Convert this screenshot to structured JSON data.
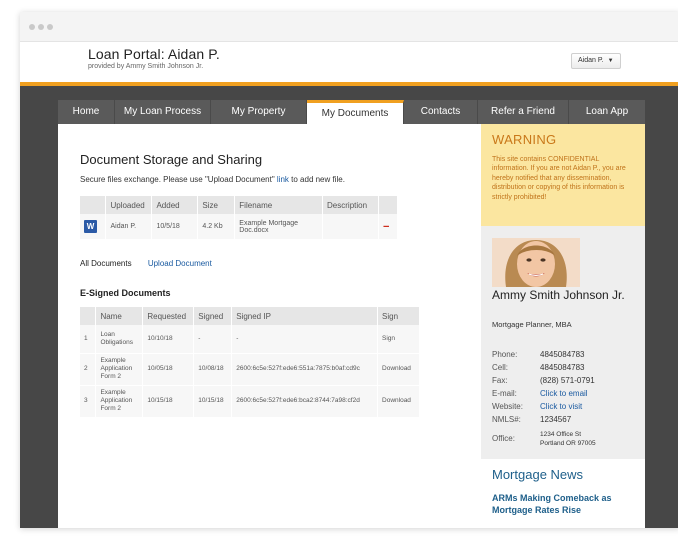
{
  "portal": {
    "title": "Loan Portal: Aidan P.",
    "subtitle": "provided by Ammy Smith Johnson Jr."
  },
  "user_menu": {
    "label": "Aidan P."
  },
  "nav": {
    "items": [
      {
        "label": "Home"
      },
      {
        "label": "My Loan Process"
      },
      {
        "label": "My Property"
      },
      {
        "label": "My Documents",
        "active": true
      },
      {
        "label": "Contacts"
      },
      {
        "label": "Refer a Friend"
      },
      {
        "label": "Loan App"
      }
    ]
  },
  "documents": {
    "title": "Document Storage and Sharing",
    "desc_prefix": "Secure files exchange. Please use \"Upload Document\" ",
    "desc_link": "link",
    "desc_suffix": " to add new file.",
    "table": {
      "headers": [
        "Uploaded",
        "Added",
        "Size",
        "Filename",
        "Description"
      ],
      "rows": [
        {
          "icon": "word-document-icon",
          "uploaded": "Aidan P.",
          "added": "10/5/18",
          "size": "4.2 Kb",
          "filename": "Example Mortgage Doc.docx",
          "description": "",
          "remove": "−"
        }
      ]
    },
    "tabs": {
      "all": "All Documents",
      "upload": "Upload Document"
    }
  },
  "esigned": {
    "title": "E-Signed Documents",
    "headers": [
      "",
      "Name",
      "Requested",
      "Signed",
      "Signed IP",
      "Sign"
    ],
    "rows": [
      {
        "num": "1",
        "name": "Loan Obligations",
        "requested": "10/10/18",
        "signed": "-",
        "ip": "-",
        "action": "Sign"
      },
      {
        "num": "2",
        "name": "Example Application Form 2",
        "requested": "10/05/18",
        "signed": "10/08/18",
        "ip": "2600:6c5e:527f:ede6:551a:7875:b0af:cd9c",
        "action": "Download"
      },
      {
        "num": "3",
        "name": "Example Application Form 2",
        "requested": "10/15/18",
        "signed": "10/15/18",
        "ip": "2600:6c5e:527f:ede6:bca2:8744:7a98:cf2d",
        "action": "Download"
      }
    ]
  },
  "warning": {
    "title": "WARNING",
    "text": "This site contains CONFIDENTIAL information. If you are not Aidan P., you are hereby notified that any dissemination, distribution or copying of this information is strictly prohibited!"
  },
  "agent": {
    "name": "Ammy Smith Johnson Jr.",
    "title": "Mortgage Planner, MBA",
    "contact": {
      "phone_label": "Phone:",
      "phone": "4845084783",
      "cell_label": "Cell:",
      "cell": "4845084783",
      "fax_label": "Fax:",
      "fax": "(828) 571-0791",
      "email_label": "E-mail:",
      "email": "Click to email",
      "website_label": "Website:",
      "website": "Click to visit",
      "nmls_label": "NMLS#:",
      "nmls": "1234567",
      "office_label": "Office:",
      "office_line1": "1234 Office St",
      "office_line2": "Portland OR 97005"
    }
  },
  "news": {
    "title": "Mortgage News",
    "headline": "ARMs Making Comeback as Mortgage Rates Rise"
  },
  "colors": {
    "accent_orange": "#f0a020",
    "dark_bg": "#474747",
    "link_blue": "#1a5aa0",
    "warning_bg": "#fbe6a0",
    "warning_text": "#c0731a",
    "delete_red": "#cc2a1a"
  }
}
